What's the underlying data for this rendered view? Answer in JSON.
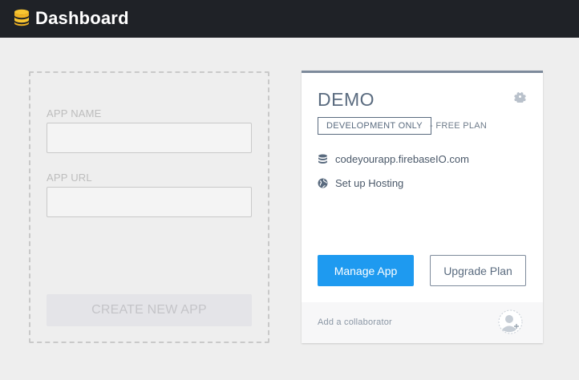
{
  "header": {
    "title": "Dashboard",
    "logo_icon": "database-stack-icon",
    "background": "#1f2227"
  },
  "new_app_form": {
    "app_name_label": "APP NAME",
    "app_name_value": "",
    "app_url_label": "APP URL",
    "app_url_value": "",
    "create_button_label": "CREATE NEW APP"
  },
  "app_card": {
    "name": "DEMO",
    "settings_icon": "gear-icon",
    "plan_badge": "DEVELOPMENT ONLY",
    "plan_text": "- FREE PLAN",
    "database_url": "codeyourapp.firebaseIO.com",
    "database_icon": "database-icon",
    "hosting_label": "Set up Hosting",
    "hosting_icon": "globe-icon",
    "manage_button_label": "Manage App",
    "upgrade_button_label": "Upgrade Plan",
    "collaborator_label": "Add a collaborator",
    "collaborator_icon": "add-user-avatar-icon"
  },
  "colors": {
    "accent": "#1e9af0",
    "card_text": "#5a6b7f",
    "card_border": "#7d8a9b",
    "logo": "#f7c531"
  }
}
